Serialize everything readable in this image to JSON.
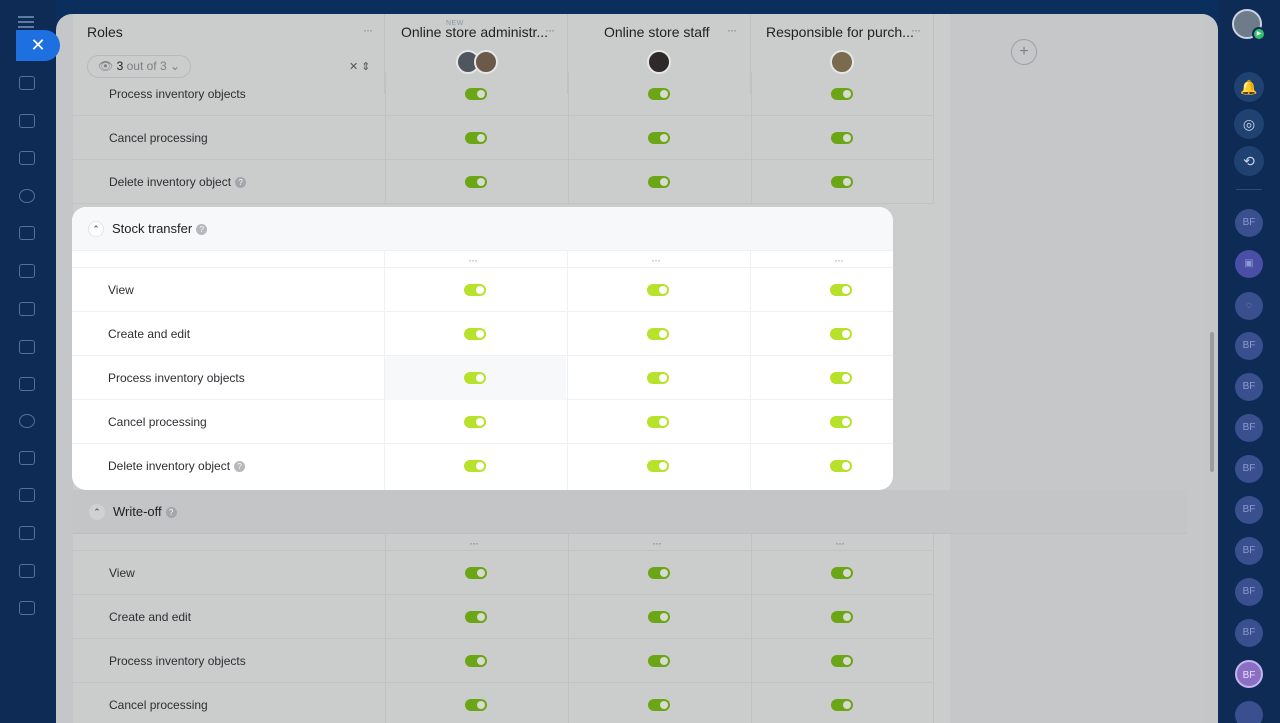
{
  "header": {
    "roles_title": "Roles",
    "counter_number": "3",
    "counter_text": "out of 3",
    "new_tag": "NEW",
    "columns": [
      {
        "title": "Online store administr..."
      },
      {
        "title": "Online store staff"
      },
      {
        "title": "Responsible for purch..."
      }
    ]
  },
  "top_rows": [
    {
      "label": "Process inventory objects",
      "help": false
    },
    {
      "label": "Cancel processing",
      "help": false
    },
    {
      "label": "Delete inventory object",
      "help": true
    }
  ],
  "stock_transfer": {
    "title": "Stock transfer",
    "rows": [
      {
        "label": "View"
      },
      {
        "label": "Create and edit"
      },
      {
        "label": "Process inventory objects"
      },
      {
        "label": "Cancel processing"
      },
      {
        "label": "Delete inventory object"
      }
    ]
  },
  "write_off": {
    "title": "Write-off",
    "rows": [
      {
        "label": "View"
      },
      {
        "label": "Create and edit"
      },
      {
        "label": "Process inventory objects"
      },
      {
        "label": "Cancel processing"
      }
    ]
  },
  "right_bar": {
    "bf_label": "BF"
  },
  "colors": {
    "toggle_on": "#b7e22b",
    "accent_blue": "#1e6fe0",
    "app_bg": "#0d2b55"
  }
}
